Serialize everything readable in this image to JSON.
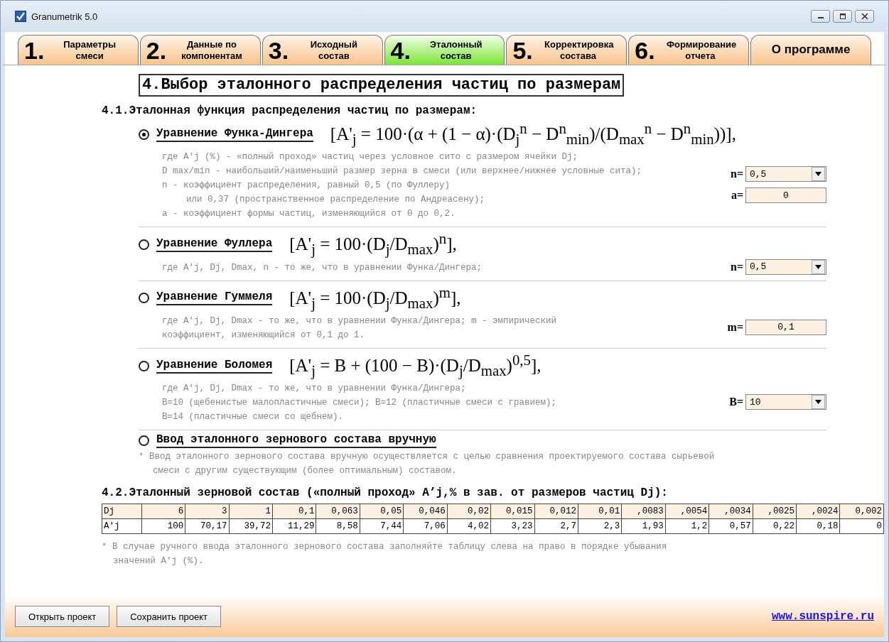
{
  "window": {
    "title": "Granumetrik 5.0"
  },
  "tabs": [
    {
      "number": "1.",
      "label": "Параметры смеси",
      "selected": false
    },
    {
      "number": "2.",
      "label": "Данные по компонентам",
      "selected": false
    },
    {
      "number": "3.",
      "label": "Исходный состав",
      "selected": false
    },
    {
      "number": "4.",
      "label": "Эталонный состав",
      "selected": true
    },
    {
      "number": "5.",
      "label": "Корректировка состава",
      "selected": false
    },
    {
      "number": "6.",
      "label": "Формирование отчета",
      "selected": false
    },
    {
      "label": "О программе",
      "selected": false
    }
  ],
  "heading": "4.Выбор эталонного распределения частиц по размерам",
  "section_1": {
    "title": "4.1.Эталонная функция распределения частиц по размерам:",
    "options": [
      {
        "label": "Уравнение Функа-Дингера",
        "selected": true,
        "formula": "[A'$_{j}$ = 100·(α + (1 − α)·(D$_{j}$$^{n}$ − D$^{n}$$_{min}$)/(D$_{max}$$^{n}$ − D$^{n}$$_{min}$))],",
        "description": [
          {
            "text": "где A'j (%) - «полный проход» частиц  через условное сито с размером ячейки Dj;",
            "indented": false
          },
          {
            "text": "D max/min - наибольший/наименьший размер зерна в смеси (или верхнее/нижнее условные сита);",
            "indented": false
          },
          {
            "text": "n - коэффициент распределения, равный 0,5 (по Фуллеру)",
            "indented": false
          },
          {
            "text": "или 0,37 (пространственное распределение по Андреасену);",
            "indented": true
          },
          {
            "text": "a - коэффициент формы частиц, изменяющийся от 0 до 0,2.",
            "indented": false
          }
        ],
        "fields": [
          {
            "kind": "dropdown",
            "label": "n=",
            "value": "0,5"
          },
          {
            "kind": "input",
            "label": "a=",
            "value": "0"
          }
        ]
      },
      {
        "label": "Уравнение Фуллера",
        "selected": false,
        "formula": "[A'$_{j}$ = 100·(D$_{j}$/D$_{max}$)$^{n}$],",
        "description": [
          {
            "text": "где A'j, Dj, Dmax, n - то же, что в уравнении Функа/Дингера;",
            "indented": false
          }
        ],
        "fields": [
          {
            "kind": "dropdown",
            "label": "n=",
            "value": "0,5"
          }
        ]
      },
      {
        "label": "Уравнение Гуммеля",
        "selected": false,
        "formula": "[A'$_{j}$ = 100·(D$_{j}$/D$_{max}$)$^{m}$],",
        "description": [
          {
            "text": "где A'j, Dj, Dmax - то же, что в уравнении Функа/Дингера; m - эмпирический",
            "indented": false
          },
          {
            "text": "коэффициент, изменяющийся от 0,1 до 1.",
            "indented": false
          }
        ],
        "fields": [
          {
            "kind": "input",
            "label": "m=",
            "value": "0,1"
          }
        ]
      },
      {
        "label": "Уравнение Боломея",
        "selected": false,
        "formula": "[A'$_{j}$ = B + (100 − B)·(D$_{j}$/D$_{max}$)$^{0,5}$],",
        "description": [
          {
            "text": "где A'j, Dj, Dmax - то же, что в уравнении Функа/Дингера;",
            "indented": false
          },
          {
            "text": "B=10 (щебенистые малопластичные смеси); B=12 (пластичные смеси с гравием);",
            "indented": false
          },
          {
            "text": "B=14 (пластичные смеси со щебнем).",
            "indented": false
          }
        ],
        "fields": [
          {
            "kind": "dropdown",
            "label": "B=",
            "value": "10"
          }
        ]
      },
      {
        "label": "Ввод эталонного зернового состава вручную",
        "selected": false,
        "description": [
          {
            "text": "* Ввод эталонного зернового состава вручную осуществляется с целью сравнения проектируемого состава сырьевой",
            "indented": false
          },
          {
            "text": "смеси с другим существующим (более оптимальным) составом.",
            "indented": true
          }
        ]
      }
    ]
  },
  "section_2": {
    "title": "4.2.Эталонный зерновой состав («полный проход» A’j,% в зав. от размеров частиц Dj):",
    "table": {
      "rows": [
        {
          "header": "Dj",
          "cells": [
            "6",
            "3",
            "1",
            "0,1",
            "0,063",
            "0,05",
            "0,046",
            "0,02",
            "0,015",
            "0,012",
            "0,01",
            ",0083",
            ",0054",
            ",0034",
            ",0025",
            ",0024",
            "0,002"
          ]
        },
        {
          "header": "A'j",
          "cells": [
            "100",
            "70,17",
            "39,72",
            "11,29",
            "8,58",
            "7,44",
            "7,06",
            "4,02",
            "3,23",
            "2,7",
            "2,3",
            "1,93",
            "1,2",
            "0,57",
            "0,22",
            "0,18",
            "0"
          ]
        }
      ]
    },
    "note": [
      {
        "text": "* В случае ручного ввода эталонного зернового состава заполняйте таблицу слева на право в порядке убывания",
        "indented": false
      },
      {
        "text": "значений A'j (%).",
        "indented": true
      }
    ]
  },
  "buttons": [
    "Открыть проект",
    "Сохранить проект"
  ],
  "link": "www.sunspire.ru"
}
